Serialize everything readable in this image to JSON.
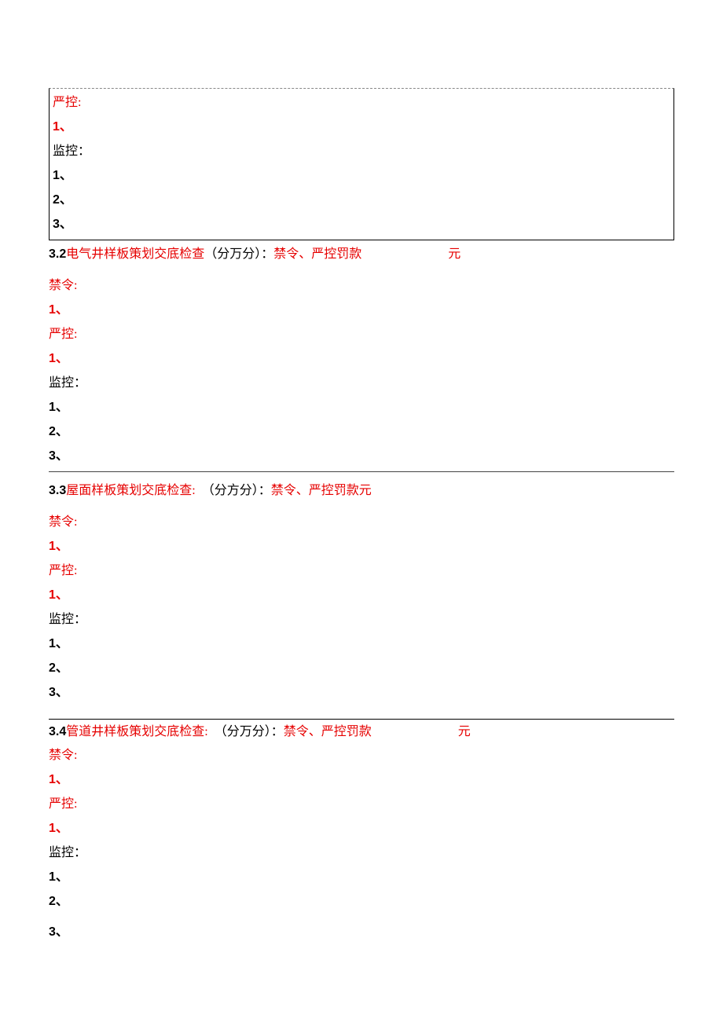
{
  "block1": {
    "yankong_label": "严控:",
    "y1": "1、",
    "jiankong_label": "监控：",
    "j1": "1、",
    "j2": "2、",
    "j3": "3、"
  },
  "sec32": {
    "sn": "3.2 ",
    "title_red_a": "电气井样板策划交底检查",
    "title_black": "（分万分）：",
    "title_red_b": "禁令、严控罚款",
    "yuan": "元",
    "jinling_label": "禁令:",
    "jl1": "1、",
    "yankong_label": "严控:",
    "y1": "1、",
    "jiankong_label": "监控：",
    "j1": "1、",
    "j2": "2、",
    "j3": "3、"
  },
  "sec33": {
    "sn": "3.3 ",
    "title_red_a": "屋面样板策划交底检查:",
    "title_black": "（分方分）：",
    "title_red_b": "禁令、严控罚款元",
    "jinling_label": "禁令:",
    "jl1": "1、",
    "yankong_label": "严控:",
    "y1": "1、",
    "jiankong_label": "监控：",
    "j1": "1、",
    "j2": "2、",
    "j3": "3、"
  },
  "sec34": {
    "sn": "3.4 ",
    "title_red_a": "管道井样板策划交底检查:",
    "title_black": "（分万分）：",
    "title_red_b": "禁令、严控罚款",
    "yuan": "元",
    "jinling_label": "禁令:",
    "jl1": "1、",
    "yankong_label": "严控:",
    "y1": "1、",
    "jiankong_label": "监控：",
    "j1": "1、",
    "j2": "2、",
    "j3": "3、"
  }
}
